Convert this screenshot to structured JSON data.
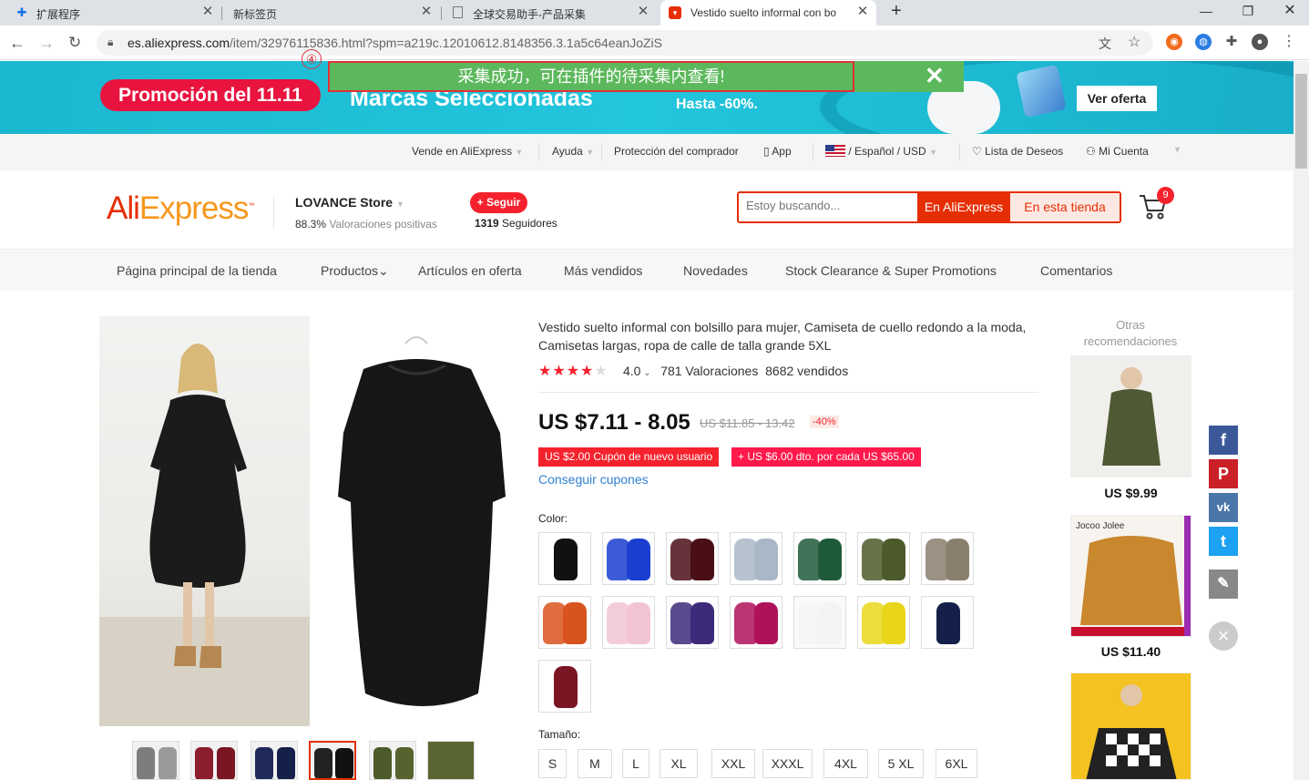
{
  "browser": {
    "tabs": [
      {
        "label": "扩展程序",
        "icon": "puzzle-icon"
      },
      {
        "label": "新标签页",
        "icon": ""
      },
      {
        "label": "全球交易助手-产品采集",
        "icon": "doc-icon"
      },
      {
        "label": "Vestido suelto informal con bo",
        "icon": "aliexpress-icon"
      }
    ],
    "new_tab": "+",
    "url_host": "es.aliexpress.com",
    "url_path": "/item/32976115836.html?spm=a219c.12010612.8148356.3.1a5c64eanJoZiS"
  },
  "banner": {
    "promo": "Promoción del 11.11",
    "headline": "Marcas Seleccionadas",
    "discount": "Hasta -60%.",
    "cta": "Ver oferta"
  },
  "notice": {
    "step": "④",
    "message": "采集成功，可在插件的待采集内查看!",
    "close": "✕"
  },
  "topnav": {
    "sell": "Vende en AliExpress",
    "help": "Ayuda",
    "protection": "Protección del comprador",
    "app": "App",
    "locale": "/ Español / USD",
    "wishlist": "Lista de Deseos",
    "account": "Mi Cuenta"
  },
  "header": {
    "logo_a": "Ali",
    "logo_b": "Express",
    "store_name": "LOVANCE Store",
    "rating_value": "88.3%",
    "rating_label": "Valoraciones positivas",
    "follow": "+ Seguir",
    "followers_count": "1319",
    "followers_label": "Seguidores",
    "search_placeholder": "Estoy buscando...",
    "search_btn_all": "En AliExpress",
    "search_btn_store": "En esta tienda",
    "cart_count": "9"
  },
  "storenav": [
    "Página principal de la tienda",
    "Productos",
    "Artículos en oferta",
    "Más vendidos",
    "Novedades",
    "Stock Clearance & Super Promotions",
    "Comentarios"
  ],
  "product": {
    "title": "Vestido suelto informal con bolsillo para mujer, Camiseta de cuello redondo a la moda, Camisetas largas, ropa de calle de talla grande 5XL",
    "rating": 4.0,
    "rating_text": "4.0",
    "reviews": "781 Valoraciones",
    "sold": "8682 vendidos",
    "price": "US $7.11 - 8.05",
    "old_price": "US $11.85 - 13.42",
    "discount": "-40%",
    "coupon_new": "US $2.00 Cupón de nuevo usuario",
    "coupon_store": "+ US $6.00 dto. por cada US $65.00",
    "get_coupons": "Conseguir cupones",
    "color_label": "Color:",
    "size_label": "Tamaño:",
    "colors": [
      "#111111",
      "#1a3fd0",
      "#4a0f16",
      "#a9b7c6",
      "#1f5a3a",
      "#4d5a2a",
      "#8a7f6e",
      "#d9531e",
      "#f2c4d3",
      "#3d2a7a",
      "#b0125a",
      "#f4f4f4",
      "#e9d61a",
      "#15204a",
      "#7a1624"
    ],
    "sizes": [
      "S",
      "M",
      "L",
      "XL",
      "XXL",
      "XXXL",
      "4XL",
      "5 XL",
      "6XL"
    ]
  },
  "sidebar": {
    "title": "Otras recomendaciones",
    "items": [
      {
        "price": "US $9.99"
      },
      {
        "price": "US $11.40",
        "brand": "Jocoo Jolee"
      }
    ]
  },
  "social": [
    "facebook-icon",
    "pinterest-icon",
    "vk-icon",
    "twitter-icon",
    "edit-icon"
  ],
  "social_glyphs": [
    "f",
    "P",
    "vk",
    "t",
    "✎"
  ]
}
